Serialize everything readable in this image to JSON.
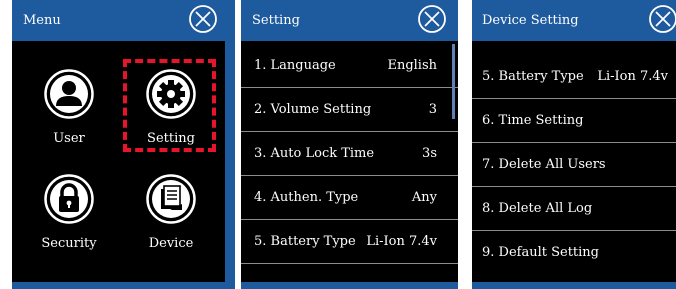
{
  "menu": {
    "title": "Menu",
    "items": [
      {
        "label": "User",
        "icon": "user-icon"
      },
      {
        "label": "Setting",
        "icon": "gear-icon"
      },
      {
        "label": "Security",
        "icon": "lock-icon"
      },
      {
        "label": "Device",
        "icon": "device-icon"
      }
    ]
  },
  "setting": {
    "title": "Setting",
    "rows": [
      {
        "label": "1. Language",
        "value": "English"
      },
      {
        "label": "2. Volume Setting",
        "value": "3"
      },
      {
        "label": "3. Auto Lock Time",
        "value": "3s"
      },
      {
        "label": "4. Authen. Type",
        "value": "Any"
      },
      {
        "label": "5. Battery Type",
        "value": "Li-Ion 7.4v"
      }
    ]
  },
  "device_setting": {
    "title": "Device Setting",
    "rows": [
      {
        "label": "5. Battery Type",
        "value": "Li-Ion 7.4v"
      },
      {
        "label": "6. Time Setting",
        "value": ""
      },
      {
        "label": "7. Delete All Users",
        "value": ""
      },
      {
        "label": "8. Delete All Log",
        "value": ""
      },
      {
        "label": "9. Default Setting",
        "value": ""
      }
    ]
  },
  "colors": {
    "header_blue": "#1d5a9e",
    "body_black": "#000000",
    "selection_red": "#e8142b",
    "divider_gray": "#8c8c8c"
  }
}
